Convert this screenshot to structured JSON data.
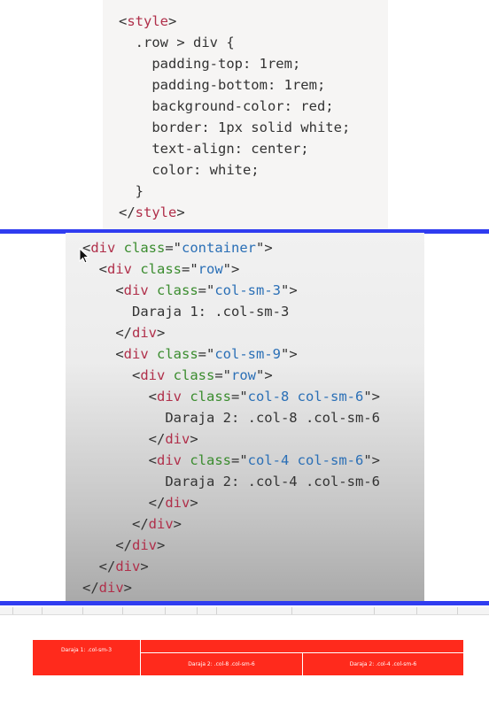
{
  "style_code": {
    "lines": [
      {
        "parts": [
          {
            "t": "<",
            "c": "pl"
          },
          {
            "t": "style",
            "c": "tag"
          },
          {
            "t": ">",
            "c": "pl"
          }
        ]
      },
      {
        "parts": [
          {
            "t": "  .row > div {",
            "c": "pl"
          }
        ]
      },
      {
        "parts": [
          {
            "t": "    padding-top: 1rem;",
            "c": "pl"
          }
        ]
      },
      {
        "parts": [
          {
            "t": "    padding-bottom: 1rem;",
            "c": "pl"
          }
        ]
      },
      {
        "parts": [
          {
            "t": "    background-color: red;",
            "c": "pl"
          }
        ]
      },
      {
        "parts": [
          {
            "t": "    border: 1px solid white;",
            "c": "pl"
          }
        ]
      },
      {
        "parts": [
          {
            "t": "    text-align: center;",
            "c": "pl"
          }
        ]
      },
      {
        "parts": [
          {
            "t": "    color: white;",
            "c": "pl"
          }
        ]
      },
      {
        "parts": [
          {
            "t": "  }",
            "c": "pl"
          }
        ]
      },
      {
        "parts": [
          {
            "t": "</",
            "c": "pl"
          },
          {
            "t": "style",
            "c": "tag"
          },
          {
            "t": ">",
            "c": "pl"
          }
        ]
      }
    ]
  },
  "html_code": {
    "lines": [
      {
        "parts": [
          {
            "t": "<",
            "c": "pl"
          },
          {
            "t": "div",
            "c": "tag"
          },
          {
            "t": " class",
            "c": "attr"
          },
          {
            "t": "=\"",
            "c": "pl"
          },
          {
            "t": "container",
            "c": "str"
          },
          {
            "t": "\">",
            "c": "pl"
          }
        ]
      },
      {
        "parts": [
          {
            "t": "  <",
            "c": "pl"
          },
          {
            "t": "div",
            "c": "tag"
          },
          {
            "t": " class",
            "c": "attr"
          },
          {
            "t": "=\"",
            "c": "pl"
          },
          {
            "t": "row",
            "c": "str"
          },
          {
            "t": "\">",
            "c": "pl"
          }
        ]
      },
      {
        "parts": [
          {
            "t": "    <",
            "c": "pl"
          },
          {
            "t": "div",
            "c": "tag"
          },
          {
            "t": " class",
            "c": "attr"
          },
          {
            "t": "=\"",
            "c": "pl"
          },
          {
            "t": "col-sm-3",
            "c": "str"
          },
          {
            "t": "\">",
            "c": "pl"
          }
        ]
      },
      {
        "parts": [
          {
            "t": "      Daraja 1: .col-sm-3",
            "c": "pl"
          }
        ]
      },
      {
        "parts": [
          {
            "t": "    </",
            "c": "pl"
          },
          {
            "t": "div",
            "c": "tag"
          },
          {
            "t": ">",
            "c": "pl"
          }
        ]
      },
      {
        "parts": [
          {
            "t": "    <",
            "c": "pl"
          },
          {
            "t": "div",
            "c": "tag"
          },
          {
            "t": " class",
            "c": "attr"
          },
          {
            "t": "=\"",
            "c": "pl"
          },
          {
            "t": "col-sm-9",
            "c": "str"
          },
          {
            "t": "\">",
            "c": "pl"
          }
        ]
      },
      {
        "parts": [
          {
            "t": "      <",
            "c": "pl"
          },
          {
            "t": "div",
            "c": "tag"
          },
          {
            "t": " class",
            "c": "attr"
          },
          {
            "t": "=\"",
            "c": "pl"
          },
          {
            "t": "row",
            "c": "str"
          },
          {
            "t": "\">",
            "c": "pl"
          }
        ]
      },
      {
        "parts": [
          {
            "t": "        <",
            "c": "pl"
          },
          {
            "t": "div",
            "c": "tag"
          },
          {
            "t": " class",
            "c": "attr"
          },
          {
            "t": "=\"",
            "c": "pl"
          },
          {
            "t": "col-8 col-sm-6",
            "c": "str"
          },
          {
            "t": "\">",
            "c": "pl"
          }
        ]
      },
      {
        "parts": [
          {
            "t": "          Daraja 2: .col-8 .col-sm-6",
            "c": "pl"
          }
        ]
      },
      {
        "parts": [
          {
            "t": "        </",
            "c": "pl"
          },
          {
            "t": "div",
            "c": "tag"
          },
          {
            "t": ">",
            "c": "pl"
          }
        ]
      },
      {
        "parts": [
          {
            "t": "        <",
            "c": "pl"
          },
          {
            "t": "div",
            "c": "tag"
          },
          {
            "t": " class",
            "c": "attr"
          },
          {
            "t": "=\"",
            "c": "pl"
          },
          {
            "t": "col-4 col-sm-6",
            "c": "str"
          },
          {
            "t": "\">",
            "c": "pl"
          }
        ]
      },
      {
        "parts": [
          {
            "t": "          Daraja 2: .col-4 .col-sm-6",
            "c": "pl"
          }
        ]
      },
      {
        "parts": [
          {
            "t": "        </",
            "c": "pl"
          },
          {
            "t": "div",
            "c": "tag"
          },
          {
            "t": ">",
            "c": "pl"
          }
        ]
      },
      {
        "parts": [
          {
            "t": "      </",
            "c": "pl"
          },
          {
            "t": "div",
            "c": "tag"
          },
          {
            "t": ">",
            "c": "pl"
          }
        ]
      },
      {
        "parts": [
          {
            "t": "    </",
            "c": "pl"
          },
          {
            "t": "div",
            "c": "tag"
          },
          {
            "t": ">",
            "c": "pl"
          }
        ]
      },
      {
        "parts": [
          {
            "t": "  </",
            "c": "pl"
          },
          {
            "t": "div",
            "c": "tag"
          },
          {
            "t": ">",
            "c": "pl"
          }
        ]
      },
      {
        "parts": [
          {
            "t": "</",
            "c": "pl"
          },
          {
            "t": "div",
            "c": "tag"
          },
          {
            "t": ">",
            "c": "pl"
          }
        ]
      }
    ]
  },
  "demo": {
    "level1": "Daraja 1: .col-sm-3",
    "level2_a": "Daraja 2: .col-8 .col-sm-6",
    "level2_b": "Daraja 2: .col-4 .col-sm-6"
  },
  "colors": {
    "divider": "#2f3cf0",
    "demo_red": "#ff2a1c",
    "tag": "#b02f4a",
    "attr": "#3a8c2e",
    "string": "#2a6fb6"
  }
}
